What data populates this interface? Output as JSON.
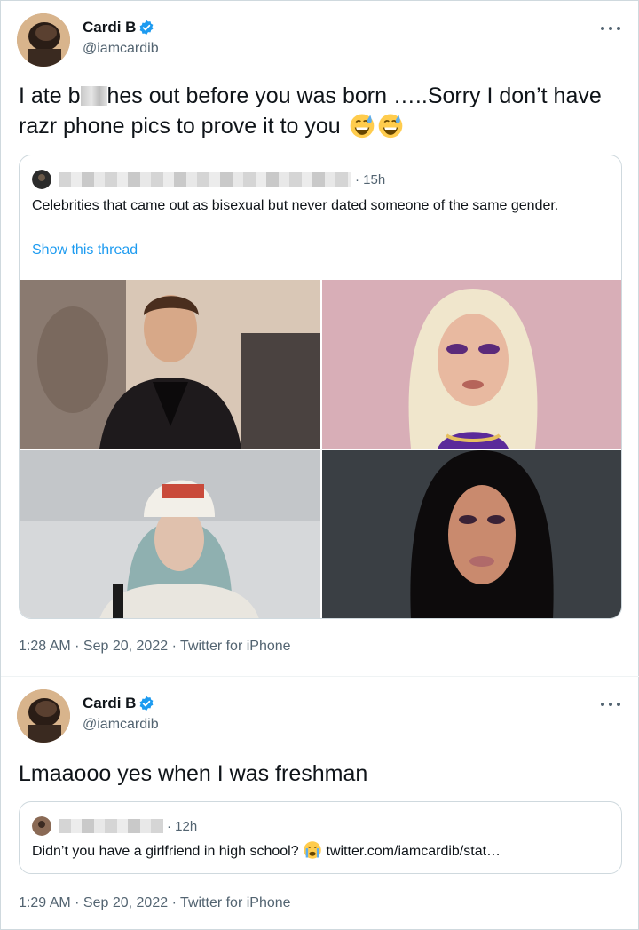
{
  "tweets": [
    {
      "author": {
        "name": "Cardi B",
        "handle": "@iamcardib",
        "verified": true
      },
      "text_before": "I ate b",
      "text_after": "hes out before you was born …..Sorry I don’t have razr phone pics to prove it to you",
      "emojis": [
        "grinning-sweat-emoji",
        "grinning-sweat-emoji"
      ],
      "quote": {
        "time": "· 15h",
        "text": "Celebrities that came out as bisexual but never dated someone of the same gender.",
        "show_thread": "Show this thread",
        "photos": [
          "man-portrait-photo",
          "blonde-woman-portrait-photo",
          "beanie-girl-portrait-photo",
          "dark-hair-woman-portrait-photo"
        ]
      },
      "meta": "1:28 AM · Sep 20, 2022 · Twitter for iPhone"
    },
    {
      "author": {
        "name": "Cardi B",
        "handle": "@iamcardib",
        "verified": true
      },
      "text": "Lmaaooo yes when I was freshman",
      "quote": {
        "time": "· 12h",
        "text": "Didn’t you have a girlfriend in high school?",
        "emoji": "crying-face-emoji",
        "link": "twitter.com/iamcardib/stat…"
      },
      "meta": "1:29 AM · Sep 20, 2022 · Twitter for iPhone"
    }
  ],
  "colors": {
    "accent": "#1d9bf0",
    "text": "#0f1419",
    "secondary": "#536471",
    "border": "#cfd9de"
  }
}
